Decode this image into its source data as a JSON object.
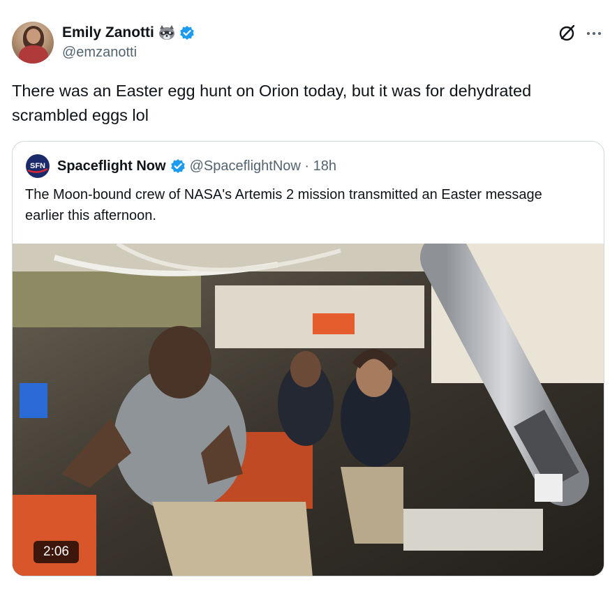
{
  "author": {
    "name": "Emily Zanotti",
    "handle": "@emzanotti",
    "emoji_icon": "raccoon-icon",
    "verified_color": "#1d9bf0"
  },
  "tweet": {
    "text": "There was an Easter egg hunt on Orion today, but it was for dehydrated scrambled eggs lol"
  },
  "quoted": {
    "logo_text": "SFN",
    "name": "Spaceflight Now",
    "handle_meta": "@SpaceflightNow · 18h",
    "text": "The Moon-bound crew of NASA's Artemis 2 mission transmitted an Easter message earlier this afternoon.",
    "video": {
      "duration": "2:06"
    }
  },
  "colors": {
    "text_primary": "#0f1419",
    "text_secondary": "#536471",
    "border": "#cfd9de",
    "logo_bg": "#1b2a6b",
    "logo_accent": "#d8282f"
  }
}
